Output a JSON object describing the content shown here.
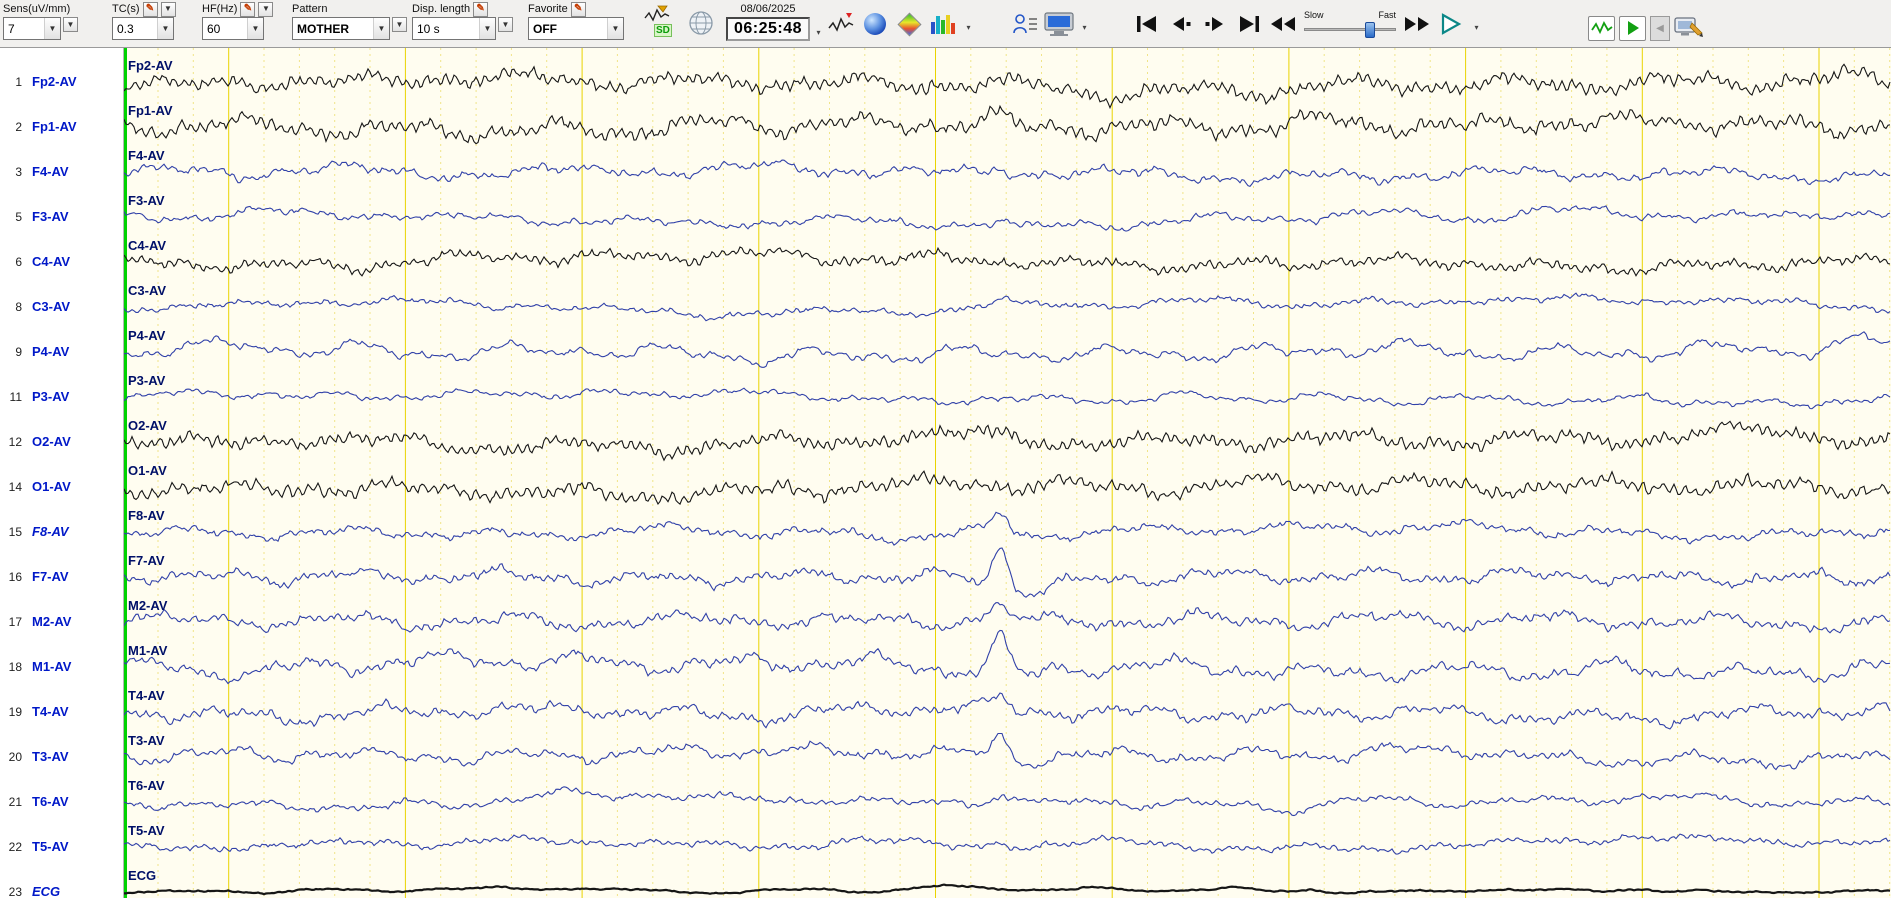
{
  "toolbar": {
    "sens": {
      "label": "Sens(uV/mm)",
      "value": "7"
    },
    "tc": {
      "label": "TC(s)",
      "value": "0.3"
    },
    "hf": {
      "label": "HF(Hz)",
      "value": "60"
    },
    "pattern": {
      "label": "Pattern",
      "value": "MOTHER"
    },
    "disp_length": {
      "label": "Disp. length",
      "value": "10 s"
    },
    "favorite": {
      "label": "Favorite",
      "value": "OFF"
    },
    "sd_badge": "SD",
    "date": "08/06/2025",
    "time": "06:25:48",
    "speed": {
      "slow_label": "Slow",
      "fast_label": "Fast"
    }
  },
  "grid": {
    "seconds": 10,
    "minor_per_major": 5,
    "background": "#fffdf0",
    "major_color": "#e9d400",
    "minor_color": "#f0e488",
    "cursor_color": "#00d200"
  },
  "colors": {
    "trace_black": "#161616",
    "trace_blue": "#3141a8",
    "plot_label_navy": "#001068",
    "channel_label_blue": "#0018c8"
  },
  "channels": [
    {
      "num": "1",
      "label": "Fp2-AV",
      "color": "#161616",
      "amp": 9,
      "hf": 4,
      "fast": 3.5,
      "spike": 0,
      "italic": false,
      "lw": 1.1
    },
    {
      "num": "2",
      "label": "Fp1-AV",
      "color": "#161616",
      "amp": 10,
      "hf": 4,
      "fast": 3.5,
      "spike": -9,
      "italic": false,
      "lw": 1.1
    },
    {
      "num": "3",
      "label": "F4-AV",
      "color": "#3141a8",
      "amp": 8,
      "hf": 2.5,
      "fast": 1.5,
      "spike": -8,
      "italic": false,
      "lw": 1.1
    },
    {
      "num": "5",
      "label": "F3-AV",
      "color": "#3141a8",
      "amp": 6,
      "hf": 2,
      "fast": 1.2,
      "spike": -6,
      "italic": false,
      "lw": 1.1
    },
    {
      "num": "6",
      "label": "C4-AV",
      "color": "#161616",
      "amp": 7,
      "hf": 3,
      "fast": 2.5,
      "spike": 0,
      "italic": false,
      "lw": 1.1
    },
    {
      "num": "8",
      "label": "C3-AV",
      "color": "#3141a8",
      "amp": 5,
      "hf": 2,
      "fast": 1.2,
      "spike": -5,
      "italic": false,
      "lw": 1.1
    },
    {
      "num": "9",
      "label": "P4-AV",
      "color": "#3141a8",
      "amp": 10,
      "hf": 2,
      "fast": 1,
      "spike": 0,
      "italic": false,
      "lw": 1.1
    },
    {
      "num": "11",
      "label": "P3-AV",
      "color": "#3141a8",
      "amp": 5.5,
      "hf": 1.5,
      "fast": 1,
      "spike": 0,
      "italic": false,
      "lw": 1.1
    },
    {
      "num": "12",
      "label": "O2-AV",
      "color": "#161616",
      "amp": 8,
      "hf": 4,
      "fast": 3.5,
      "spike": 0,
      "italic": false,
      "lw": 1.1
    },
    {
      "num": "14",
      "label": "O1-AV",
      "color": "#161616",
      "amp": 9,
      "hf": 4,
      "fast": 3.5,
      "spike": 0,
      "italic": false,
      "lw": 1.1
    },
    {
      "num": "15",
      "label": "F8-AV",
      "color": "#3141a8",
      "amp": 6.5,
      "hf": 2.5,
      "fast": 1.5,
      "spike": -18,
      "italic": true,
      "lw": 1.1
    },
    {
      "num": "16",
      "label": "F7-AV",
      "color": "#3141a8",
      "amp": 8,
      "hf": 3,
      "fast": 1.8,
      "spike": -38,
      "italic": false,
      "lw": 1.1
    },
    {
      "num": "17",
      "label": "M2-AV",
      "color": "#3141a8",
      "amp": 9,
      "hf": 3,
      "fast": 2,
      "spike": -16,
      "italic": false,
      "lw": 1.1
    },
    {
      "num": "18",
      "label": "M1-AV",
      "color": "#3141a8",
      "amp": 10,
      "hf": 3,
      "fast": 2,
      "spike": -34,
      "italic": false,
      "lw": 1.1
    },
    {
      "num": "19",
      "label": "T4-AV",
      "color": "#3141a8",
      "amp": 9,
      "hf": 3,
      "fast": 1.8,
      "spike": -10,
      "italic": false,
      "lw": 1.1
    },
    {
      "num": "20",
      "label": "T3-AV",
      "color": "#3141a8",
      "amp": 8,
      "hf": 2.5,
      "fast": 1.5,
      "spike": -20,
      "italic": false,
      "lw": 1.1
    },
    {
      "num": "21",
      "label": "T6-AV",
      "color": "#3141a8",
      "amp": 6,
      "hf": 2,
      "fast": 1.2,
      "spike": -8,
      "italic": false,
      "lw": 1.1
    },
    {
      "num": "22",
      "label": "T5-AV",
      "color": "#3141a8",
      "amp": 5,
      "hf": 2,
      "fast": 1.2,
      "spike": -6,
      "italic": false,
      "lw": 1.1
    },
    {
      "num": "23",
      "label": "ECG",
      "color": "#161616",
      "amp": 1.2,
      "hf": 0.5,
      "fast": 0.3,
      "spike": 0,
      "italic": true,
      "lw": 2.2
    }
  ]
}
